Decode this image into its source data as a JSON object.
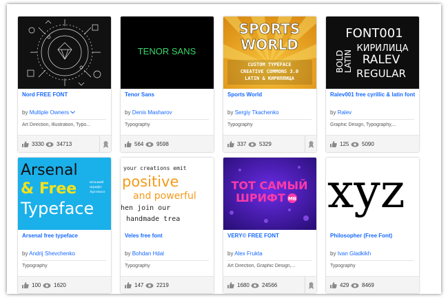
{
  "colors": {
    "link": "#1769ff",
    "text": "#555555",
    "stats_bg": "#f4f4f4"
  },
  "cards": [
    {
      "title": "Nord FREE FONT",
      "by": "by",
      "owner": "Multiple Owners",
      "owner_dropdown": true,
      "fields": "Art Direction, Illustration, Typo...",
      "appreciations": "3330",
      "views": "34713",
      "featured": true,
      "thumb_icon": "line-art-circle-illustration"
    },
    {
      "title": "Tenor Sans",
      "by": "by",
      "owner": "Denis Masharov",
      "fields": "Typography",
      "appreciations": "564",
      "views": "9598",
      "featured": false,
      "thumb_text": "TENOR SANS"
    },
    {
      "title": "Sports World",
      "by": "by",
      "owner": "Sergiy Tkachenko",
      "fields": "Typography",
      "appreciations": "337",
      "views": "5329",
      "featured": true,
      "thumb_text": [
        "SPORTS",
        "WORLD",
        "CUSTOM TYPEFACE",
        "CREATIVE COMMONS 3.0",
        "LATIN & КИРИЛЛИЦА"
      ]
    },
    {
      "title": "Ralev001 free cyrillic & latin font",
      "by": "by",
      "owner": "Ralev",
      "fields": "Graphic Design, Typography,...",
      "appreciations": "125",
      "views": "5090",
      "featured": false,
      "thumb_text": [
        "FONT001",
        "КИРИЛИЦА",
        "LATIN",
        "BOLD",
        "RALEV",
        "REGULAR"
      ]
    },
    {
      "title": "Arsenal free typeface",
      "by": "by",
      "owner": "Andrij Shevchenko",
      "fields": "Typography",
      "appreciations": "100",
      "views": "1620",
      "featured": false,
      "thumb_text": [
        "Arsenal",
        "& Free",
        "вільний",
        "шрифт",
        "Арсенал",
        "Typeface"
      ]
    },
    {
      "title": "Veles free font",
      "by": "by",
      "owner": "Bohdan Hdal",
      "fields": "Typography",
      "appreciations": "147",
      "views": "2219",
      "featured": false,
      "thumb_text": [
        "your creations emit",
        "positive",
        "and powerful",
        "hen join our",
        "handmade trea"
      ]
    },
    {
      "title": "VERY© FREE FONT",
      "by": "by",
      "owner": "Alex Frukta",
      "fields": "Art Direction, Graphic Design,...",
      "appreciations": "1680",
      "views": "24566",
      "featured": true,
      "thumb_text": [
        "ТОТ САМЫЙ",
        "ШРИФТ",
        "МВ"
      ]
    },
    {
      "title": "Philosopher (Free Font)",
      "by": "by",
      "owner": "Ivan Gladkikh",
      "fields": "Typography",
      "appreciations": "429",
      "views": "8469",
      "featured": false,
      "thumb_text": "xyz"
    }
  ]
}
